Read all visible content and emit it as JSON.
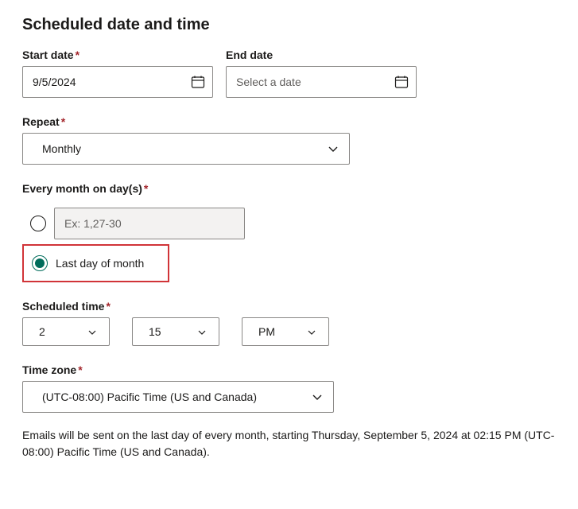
{
  "section_title": "Scheduled date and time",
  "start_date": {
    "label": "Start date",
    "required": true,
    "value": "9/5/2024"
  },
  "end_date": {
    "label": "End date",
    "required": false,
    "placeholder": "Select a date",
    "value": ""
  },
  "repeat": {
    "label": "Repeat",
    "required": true,
    "value": "Monthly"
  },
  "day_pattern": {
    "label": "Every month on day(s)",
    "required": true,
    "specific_days_placeholder": "Ex: 1,27-30",
    "last_day_label": "Last day of month",
    "selected": "last_day"
  },
  "scheduled_time": {
    "label": "Scheduled time",
    "required": true,
    "hour": "2",
    "minute": "15",
    "ampm": "PM"
  },
  "time_zone": {
    "label": "Time zone",
    "required": true,
    "value": "(UTC-08:00) Pacific Time (US and Canada)"
  },
  "summary": "Emails will be sent on the last day of every month, starting Thursday, September 5, 2024 at 02:15 PM (UTC-08:00) Pacific Time (US and Canada)."
}
